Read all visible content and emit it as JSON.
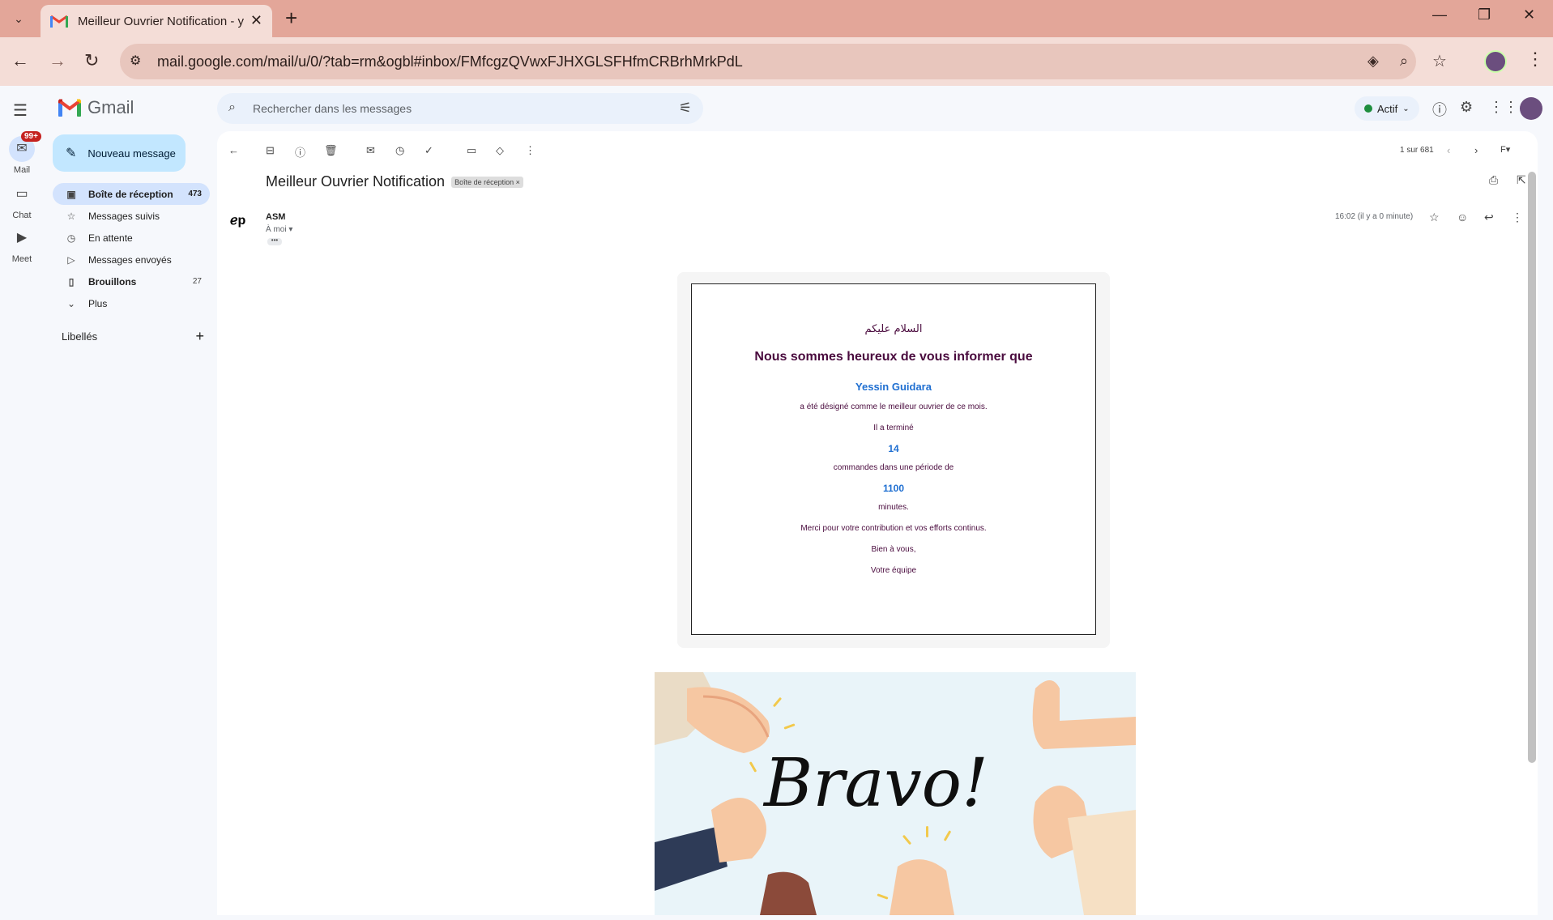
{
  "browser": {
    "tab_title": "Meilleur Ouvrier Notification - y",
    "url": "mail.google.com/mail/u/0/?tab=rm&ogbl#inbox/FMfcgzQVwxFJHXGLSFHfmCRBrhMrkPdL"
  },
  "rail": {
    "mail_label": "Mail",
    "mail_badge": "99+",
    "chat_label": "Chat",
    "meet_label": "Meet"
  },
  "header": {
    "logo_text": "Gmail",
    "search_placeholder": "Rechercher dans les messages",
    "status_label": "Actif"
  },
  "sidebar": {
    "compose_label": "Nouveau message",
    "items": [
      {
        "label": "Boîte de réception",
        "count": "473",
        "icon": "inbox-icon"
      },
      {
        "label": "Messages suivis",
        "count": "",
        "icon": "star-icon"
      },
      {
        "label": "En attente",
        "count": "",
        "icon": "clock-icon"
      },
      {
        "label": "Messages envoyés",
        "count": "",
        "icon": "send-icon"
      },
      {
        "label": "Brouillons",
        "count": "27",
        "icon": "draft-icon"
      },
      {
        "label": "Plus",
        "count": "",
        "icon": "chevron-down-icon"
      }
    ],
    "labels_title": "Libellés"
  },
  "toolbar": {
    "pager": "1 sur 681"
  },
  "message": {
    "subject": "Meilleur Ouvrier Notification",
    "label_chip": "Boîte de réception",
    "sender": "ASM",
    "to": "À moi",
    "time": "16:02 (il y a 0 minute)"
  },
  "email_body": {
    "greeting": "السلام عليكم",
    "heading": "Nous sommes heureux de vous informer que",
    "worker_name": "Yessin Guidara",
    "line1": "a été désigné comme le meilleur ouvrier de ce mois.",
    "line2": "Il a terminé",
    "orders": "14",
    "line3": "commandes dans une période de",
    "minutes_value": "1100",
    "line4": "minutes.",
    "line5": "Merci pour votre contribution et vos efforts continus.",
    "line6": "Bien à vous,",
    "line7": "Votre équipe",
    "image_text": "Bravo!"
  },
  "colors": {
    "browser_chrome": "#e3a699",
    "compose": "#c2e7ff",
    "active_nav": "#d3e3fd",
    "email_text": "#4a0b3e",
    "email_accent": "#1f6fd1"
  }
}
